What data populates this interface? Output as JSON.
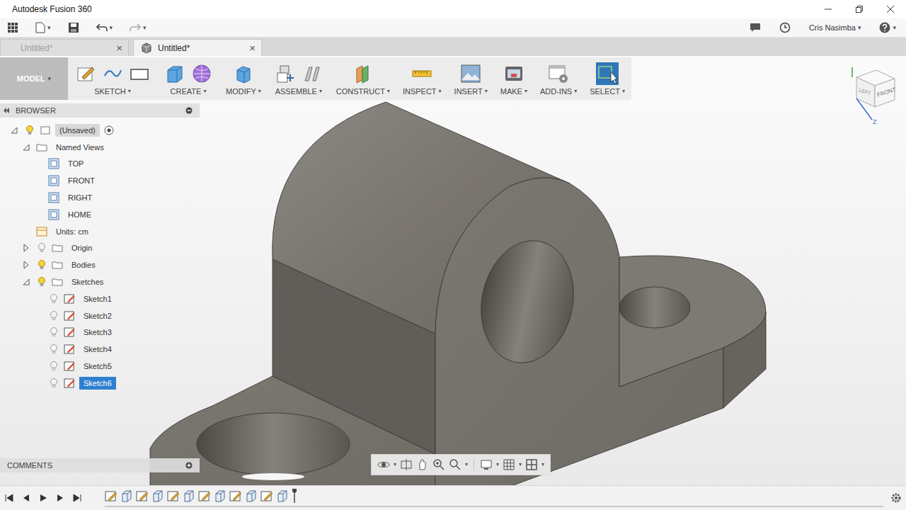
{
  "window": {
    "title": "Autodesk Fusion 360"
  },
  "caret": "▾",
  "close": "×",
  "user": {
    "name": "Cris Nasimba"
  },
  "tabs": [
    {
      "label": "Untitled*",
      "selected": false
    },
    {
      "label": "Untitled*",
      "selected": true
    }
  ],
  "workspace": {
    "label": "MODEL"
  },
  "toolbar": [
    {
      "label": "SKETCH",
      "selected": false
    },
    {
      "label": "CREATE",
      "selected": false
    },
    {
      "label": "MODIFY",
      "selected": false
    },
    {
      "label": "ASSEMBLE",
      "selected": false
    },
    {
      "label": "CONSTRUCT",
      "selected": false
    },
    {
      "label": "INSPECT",
      "selected": false
    },
    {
      "label": "INSERT",
      "selected": false
    },
    {
      "label": "MAKE",
      "selected": false
    },
    {
      "label": "ADD-INS",
      "selected": false
    },
    {
      "label": "SELECT",
      "selected": true
    }
  ],
  "browser": {
    "title": "BROWSER",
    "items": [
      {
        "label": "(Unsaved)",
        "level": 0,
        "kind": "root",
        "expanded": true,
        "visible": true,
        "selected": false
      },
      {
        "label": "Named Views",
        "level": 1,
        "kind": "folder",
        "expanded": true,
        "selected": false
      },
      {
        "label": "TOP",
        "level": 2,
        "kind": "view",
        "selected": false
      },
      {
        "label": "FRONT",
        "level": 2,
        "kind": "view",
        "selected": false
      },
      {
        "label": "RIGHT",
        "level": 2,
        "kind": "view",
        "selected": false
      },
      {
        "label": "HOME",
        "level": 2,
        "kind": "view",
        "selected": false
      },
      {
        "label": "Units: cm",
        "level": 1,
        "kind": "units",
        "selected": false
      },
      {
        "label": "Origin",
        "level": 1,
        "kind": "folder",
        "expanded": false,
        "visible": false,
        "selected": false
      },
      {
        "label": "Bodies",
        "level": 1,
        "kind": "folder",
        "expanded": false,
        "visible": true,
        "selected": false
      },
      {
        "label": "Sketches",
        "level": 1,
        "kind": "folder",
        "expanded": true,
        "visible": true,
        "selected": false
      },
      {
        "label": "Sketch1",
        "level": 2,
        "kind": "sketch",
        "visible": false,
        "selected": false
      },
      {
        "label": "Sketch2",
        "level": 2,
        "kind": "sketch",
        "visible": false,
        "selected": false
      },
      {
        "label": "Sketch3",
        "level": 2,
        "kind": "sketch",
        "visible": false,
        "selected": false
      },
      {
        "label": "Sketch4",
        "level": 2,
        "kind": "sketch",
        "visible": false,
        "selected": false
      },
      {
        "label": "Sketch5",
        "level": 2,
        "kind": "sketch",
        "visible": false,
        "selected": false
      },
      {
        "label": "Sketch6",
        "level": 2,
        "kind": "sketch",
        "visible": false,
        "selected": true
      }
    ]
  },
  "comments": {
    "title": "COMMENTS"
  },
  "viewcube": {
    "faces": [
      "LEFT",
      "FRONT"
    ],
    "axis": "Z"
  },
  "timeline": {
    "features": [
      {
        "kind": "sketch"
      },
      {
        "kind": "extrude"
      },
      {
        "kind": "sketch"
      },
      {
        "kind": "extrude"
      },
      {
        "kind": "sketch"
      },
      {
        "kind": "extrude"
      },
      {
        "kind": "sketch"
      },
      {
        "kind": "extrude"
      },
      {
        "kind": "sketch"
      },
      {
        "kind": "extrude"
      },
      {
        "kind": "sketch"
      },
      {
        "kind": "extrude"
      }
    ]
  }
}
